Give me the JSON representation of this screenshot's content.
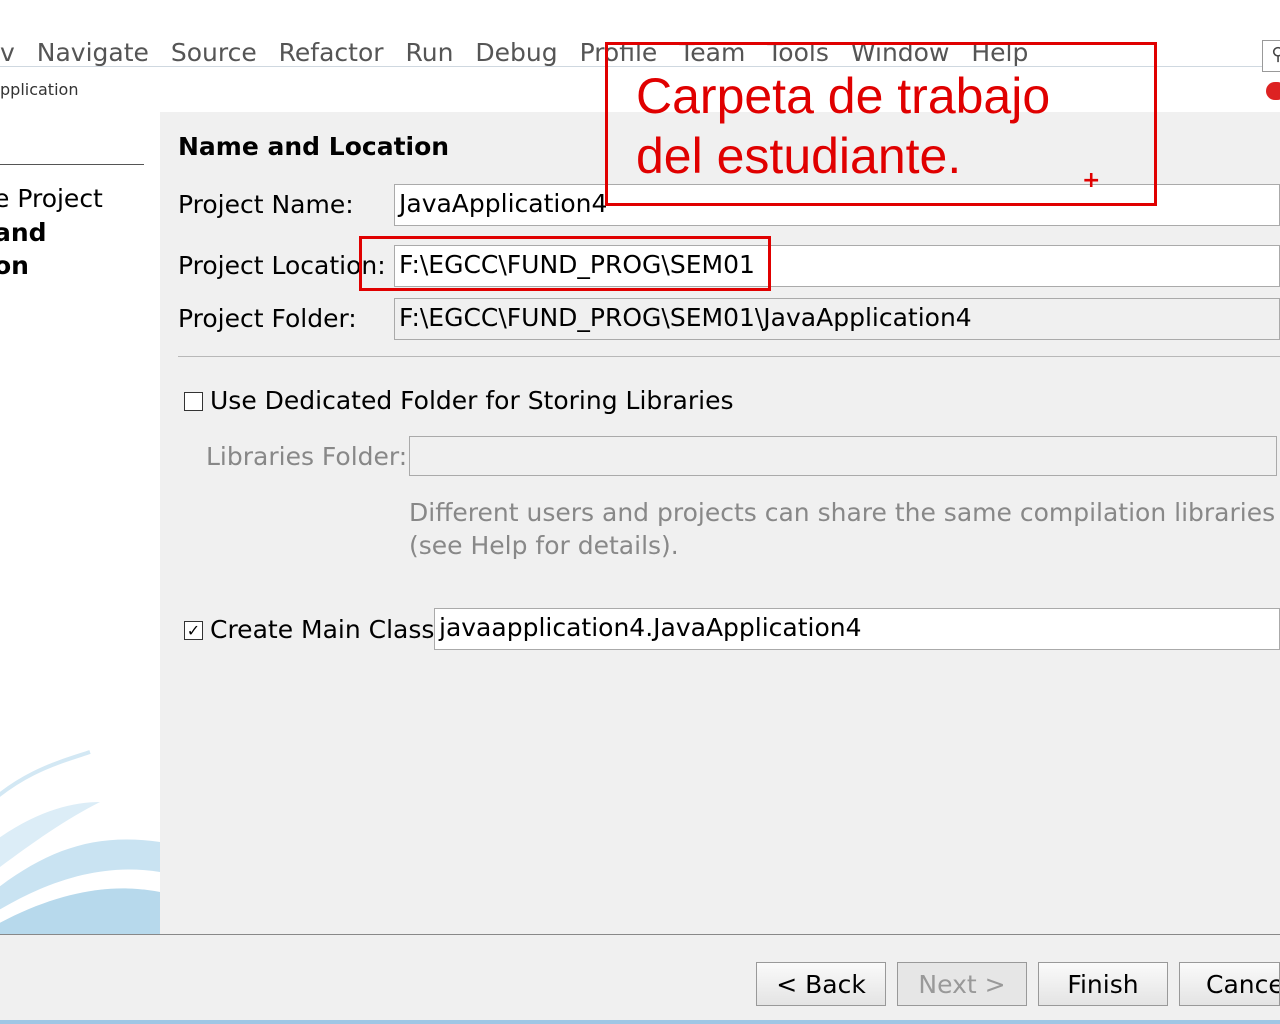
{
  "menu": [
    "v",
    "Navigate",
    "Source",
    "Refactor",
    "Run",
    "Debug",
    "Profile",
    "Team",
    "Tools",
    "Window",
    "Help"
  ],
  "window_title": "pplication",
  "steps": {
    "step1": "e Project",
    "step2_line1": " and",
    "step2_line2": "on"
  },
  "section_title": "Name and Location",
  "project_name": {
    "label": "Project Name:",
    "value": "JavaApplication4"
  },
  "project_location": {
    "label": "Project Location:",
    "value": "F:\\EGCC\\FUND_PROG\\SEM01"
  },
  "project_folder": {
    "label": "Project Folder:",
    "value": "F:\\EGCC\\FUND_PROG\\SEM01\\JavaApplication4"
  },
  "dedicated_folder": {
    "label": "Use Dedicated Folder for Storing Libraries",
    "checked": false
  },
  "libraries_folder": {
    "label": "Libraries Folder:",
    "value": ""
  },
  "libraries_help": {
    "line1": "Different users and projects can share the same compilation libraries",
    "line2": "(see Help for details)."
  },
  "main_class": {
    "label": "Create Main Class",
    "checked": true,
    "value": "javaapplication4.JavaApplication4"
  },
  "buttons": {
    "back": "< Back",
    "next": "Next >",
    "finish": "Finish",
    "cancel": "Cancel"
  },
  "annotation": {
    "line1": "Carpeta de trabajo",
    "line2": "del estudiante.",
    "color": "#e00000"
  }
}
